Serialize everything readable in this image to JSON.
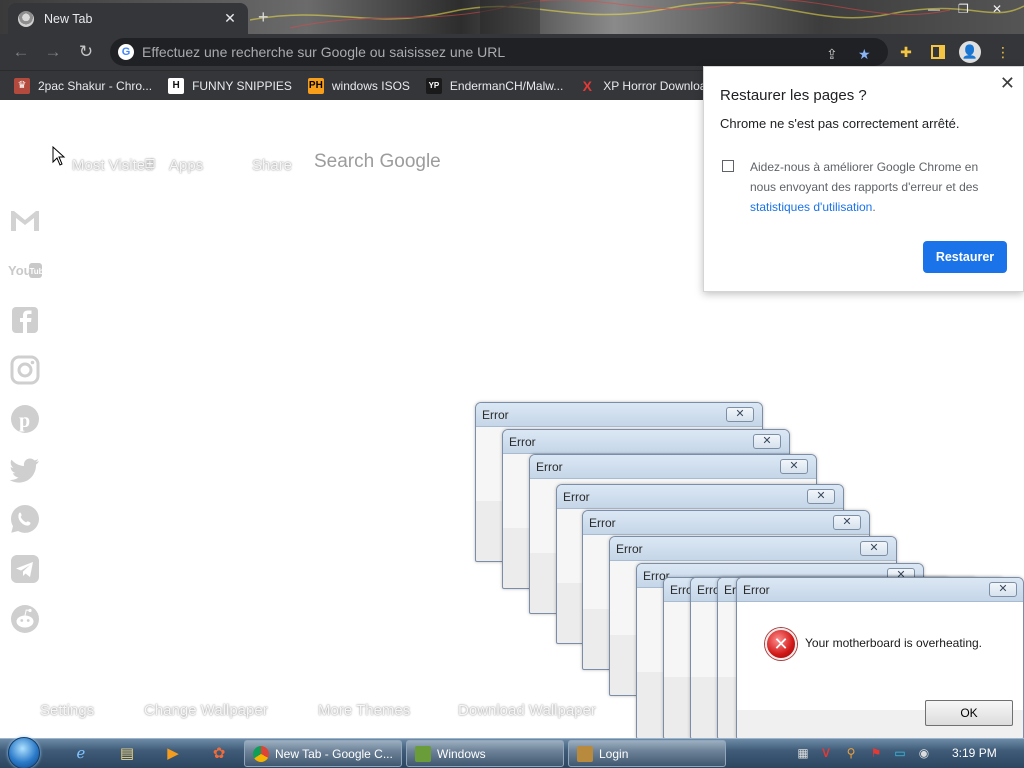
{
  "browser": {
    "tab_title": "New Tab",
    "tab_close": "✕",
    "new_tab": "+",
    "omnibox_placeholder": "Effectuez une recherche sur Google ou saisissez une URL",
    "window_controls": {
      "minimize": "—",
      "maximize": "❐",
      "close": "✕"
    }
  },
  "bookmarks": [
    {
      "label": "2pac Shakur - Chro...",
      "icon": "H",
      "color": "#b24b3d"
    },
    {
      "label": "FUNNY SNIPPIES",
      "icon": "H",
      "color": "#111111"
    },
    {
      "label": "windows ISOS",
      "icon": "PH",
      "color": "#f79e1b"
    },
    {
      "label": "EndermanCH/Malw...",
      "icon": "YP",
      "color": "#1a1a1a"
    },
    {
      "label": "XP Horror Download",
      "icon": "X",
      "color": "#d31919"
    }
  ],
  "page": {
    "links": {
      "most_visited": "Most Visited",
      "apps": "Apps",
      "share": "Share"
    },
    "search_label": "Search Google",
    "footer": {
      "settings": "Settings",
      "change_wallpaper": "Change Wallpaper",
      "more_themes": "More Themes",
      "download_wallpaper": "Download Wallpaper"
    }
  },
  "restore_popup": {
    "title": "Restaurer les pages ?",
    "message": "Chrome ne s'est pas correctement arrêté.",
    "checkbox_text": "Aidez-nous à améliorer Google Chrome en nous envoyant des rapports d'erreur et des",
    "checkbox_link": "statistiques d'utilisation",
    "checkbox_period": ".",
    "button": "Restaurer",
    "close": "✕"
  },
  "error_windows": {
    "title": "Error",
    "close": "✕",
    "message": "Your motherboard is overheating.",
    "ok": "OK",
    "icon_glyph": "✕"
  },
  "taskbar": {
    "buttons": [
      {
        "label": "New Tab - Google C...",
        "icon_color": "#db4437"
      },
      {
        "label": "Windows",
        "icon_color": "#6a9c3a"
      },
      {
        "label": "Login",
        "icon_color": "#b88a3d"
      }
    ],
    "clock": "3:19 PM"
  }
}
